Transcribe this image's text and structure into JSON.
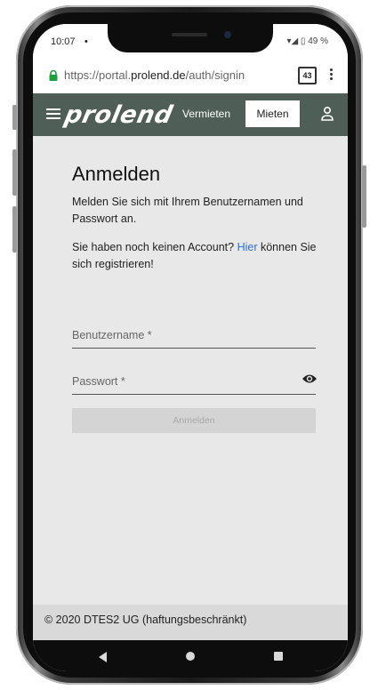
{
  "status": {
    "time": "10:07",
    "dot": "•",
    "indicators": "▾◢ ▯ 49 %"
  },
  "browser": {
    "url_prefix": "https://portal.",
    "url_domain": "prolend.de",
    "url_path": "/auth/signin",
    "tab_count": "43"
  },
  "header": {
    "logo": "prolend",
    "nav": {
      "vermieten": "Vermieten",
      "mieten": "Mieten"
    }
  },
  "login": {
    "title": "Anmelden",
    "intro": "Melden Sie sich mit Ihrem Benutzernamen und Passwort an.",
    "register_before": "Sie haben noch keinen Account? ",
    "register_link": "Hier",
    "register_after": " können Sie sich registrieren!",
    "username_placeholder": "Benutzername *",
    "password_placeholder": "Passwort *",
    "submit_label": "Anmelden"
  },
  "footer": {
    "text": "© 2020 DTES2 UG (haftungsbeschränkt)"
  },
  "colors": {
    "appbar": "#4f5f57",
    "link": "#2a6fdb",
    "lock": "#1e9e3e"
  }
}
